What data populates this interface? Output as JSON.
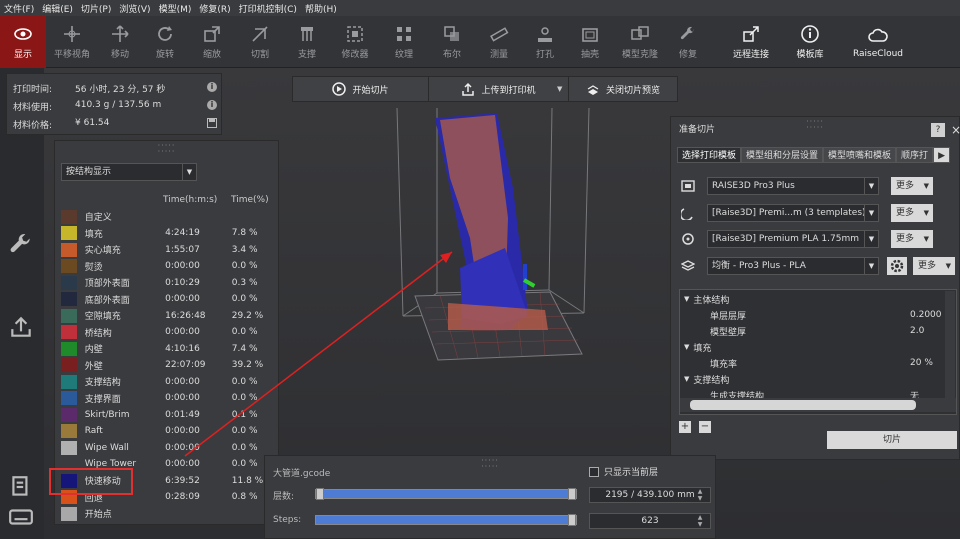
{
  "menu": [
    "文件(F)",
    "编辑(E)",
    "切片(P)",
    "浏览(V)",
    "模型(M)",
    "修复(R)",
    "打印机控制(C)",
    "帮助(H)"
  ],
  "toolbar": [
    {
      "label": "显示",
      "icon": "eye-icon",
      "active": true
    },
    {
      "label": "平移视角",
      "icon": "pan-icon"
    },
    {
      "label": "移动",
      "icon": "move-icon"
    },
    {
      "label": "旋转",
      "icon": "rotate-icon"
    },
    {
      "label": "缩放",
      "icon": "scale-icon"
    },
    {
      "label": "切割",
      "icon": "cut-icon"
    },
    {
      "label": "支撑",
      "icon": "support-icon"
    },
    {
      "label": "修改器",
      "icon": "modifier-icon"
    },
    {
      "label": "纹理",
      "icon": "texture-icon"
    },
    {
      "label": "布尔",
      "icon": "boolean-icon"
    },
    {
      "label": "测量",
      "icon": "ruler-icon"
    },
    {
      "label": "打孔",
      "icon": "punch-icon"
    },
    {
      "label": "抽壳",
      "icon": "hollow-icon"
    },
    {
      "label": "模型克隆",
      "icon": "clone-icon"
    },
    {
      "label": "修复",
      "icon": "repair-icon"
    },
    {
      "label": "远程连接",
      "icon": "remote-icon",
      "bright": true
    },
    {
      "label": "模板库",
      "icon": "library-icon",
      "bright": true
    },
    {
      "label": "RaiseCloud",
      "icon": "cloud-icon",
      "bright": true
    }
  ],
  "info": [
    {
      "label": "打印时间:",
      "value": "56 小时, 23 分, 57 秒",
      "icon": "info-icon"
    },
    {
      "label": "材料使用:",
      "value": "410.3 g / 137.56 m",
      "icon": "info-icon"
    },
    {
      "label": "材料价格:",
      "value": "¥ 61.54",
      "icon": "save-icon"
    }
  ],
  "top_buttons": [
    "开始切片",
    "上传到打印机",
    "关闭切片预览"
  ],
  "legend": {
    "mode": "按结构显示",
    "headers": [
      "Time(h:m:s)",
      "Time(%)"
    ],
    "rows": [
      {
        "name": "自定义",
        "color": "#5a3a2c",
        "time": "",
        "pct": ""
      },
      {
        "name": "填充",
        "color": "#c6b62a",
        "time": "4:24:19",
        "pct": "7.8 %"
      },
      {
        "name": "实心填充",
        "color": "#c65a2a",
        "time": "1:55:07",
        "pct": "3.4 %"
      },
      {
        "name": "熨烫",
        "color": "#6b4a22",
        "time": "0:00:00",
        "pct": "0.0 %"
      },
      {
        "name": "顶部外表面",
        "color": "#2a3a4a",
        "time": "0:10:29",
        "pct": "0.3 %"
      },
      {
        "name": "底部外表面",
        "color": "#22283e",
        "time": "0:00:00",
        "pct": "0.0 %"
      },
      {
        "name": "空隙填充",
        "color": "#3a6a5a",
        "time": "16:26:48",
        "pct": "29.2 %"
      },
      {
        "name": "桥结构",
        "color": "#c0303a",
        "time": "0:00:00",
        "pct": "0.0 %"
      },
      {
        "name": "内壁",
        "color": "#1f8a2a",
        "time": "4:10:16",
        "pct": "7.4 %"
      },
      {
        "name": "外壁",
        "color": "#7a1f1f",
        "time": "22:07:09",
        "pct": "39.2 %"
      },
      {
        "name": "支撑结构",
        "color": "#1f7a7a",
        "time": "0:00:00",
        "pct": "0.0 %"
      },
      {
        "name": "支撑界面",
        "color": "#2a5a9a",
        "time": "0:00:00",
        "pct": "0.0 %"
      },
      {
        "name": "Skirt/Brim",
        "color": "#5a2a6a",
        "time": "0:01:49",
        "pct": "0.1 %"
      },
      {
        "name": "Raft",
        "color": "#9a7a3a",
        "time": "0:00:00",
        "pct": "0.0 %"
      },
      {
        "name": "Wipe Wall",
        "color": "#b0b0b0",
        "time": "0:00:00",
        "pct": "0.0 %"
      },
      {
        "name": "Wipe Tower",
        "color": "#3a3b3e",
        "time": "0:00:00",
        "pct": "0.0 %"
      },
      {
        "name": "快速移动",
        "color": "#16167a",
        "time": "6:39:52",
        "pct": "11.8 %"
      },
      {
        "name": "回退",
        "color": "#d8501a",
        "time": "0:28:09",
        "pct": "0.8 %"
      },
      {
        "name": "开始点",
        "color": "#a8a8a8",
        "time": "",
        "pct": ""
      }
    ]
  },
  "print_panel": {
    "title": "准备切片",
    "help": "?",
    "close": "×",
    "tabs": [
      "选择打印模板",
      "模型组和分层设置",
      "模型喷嘴和模板",
      "顺序打"
    ],
    "tab_next": "▶",
    "selectors": [
      {
        "icon": "printer-icon",
        "value": "RAISE3D Pro3 Plus",
        "more": "更多"
      },
      {
        "icon": "nozzle-icon",
        "value": "[Raise3D] Premi...m (3 templates)",
        "more": "更多"
      },
      {
        "icon": "filament-icon",
        "value": "[Raise3D] Premium PLA 1.75mm",
        "more": "更多"
      },
      {
        "icon": "layers-icon",
        "value": "均衡 - Pro3 Plus - PLA",
        "more": "更多"
      }
    ],
    "tree": [
      {
        "k": "主体结构",
        "v": "",
        "sec": true
      },
      {
        "k": "单层层厚",
        "v": "0.2000 mm",
        "sec": false
      },
      {
        "k": "模型壁厚",
        "v": "2.0",
        "sec": false
      },
      {
        "k": "填充",
        "v": "",
        "sec": true
      },
      {
        "k": "填充率",
        "v": "20 %",
        "sec": false
      },
      {
        "k": "支撑结构",
        "v": "",
        "sec": true
      },
      {
        "k": "生成支撑结构",
        "v": "无",
        "sec": false
      }
    ],
    "add": "+",
    "remove": "−",
    "slice_button": "切片"
  },
  "bottom": {
    "file": "大管道.gcode",
    "only_current": "只显示当前层",
    "layers_label": "层数:",
    "layers_value": "2195 / 439.100 mm",
    "layers_fraction": 1.0,
    "steps_label": "Steps:",
    "steps_value": "623",
    "steps_fraction": 1.0
  },
  "colors": {
    "accent": "#8b1616",
    "highlight": "#e03030",
    "slider": "#4e7bd4"
  }
}
